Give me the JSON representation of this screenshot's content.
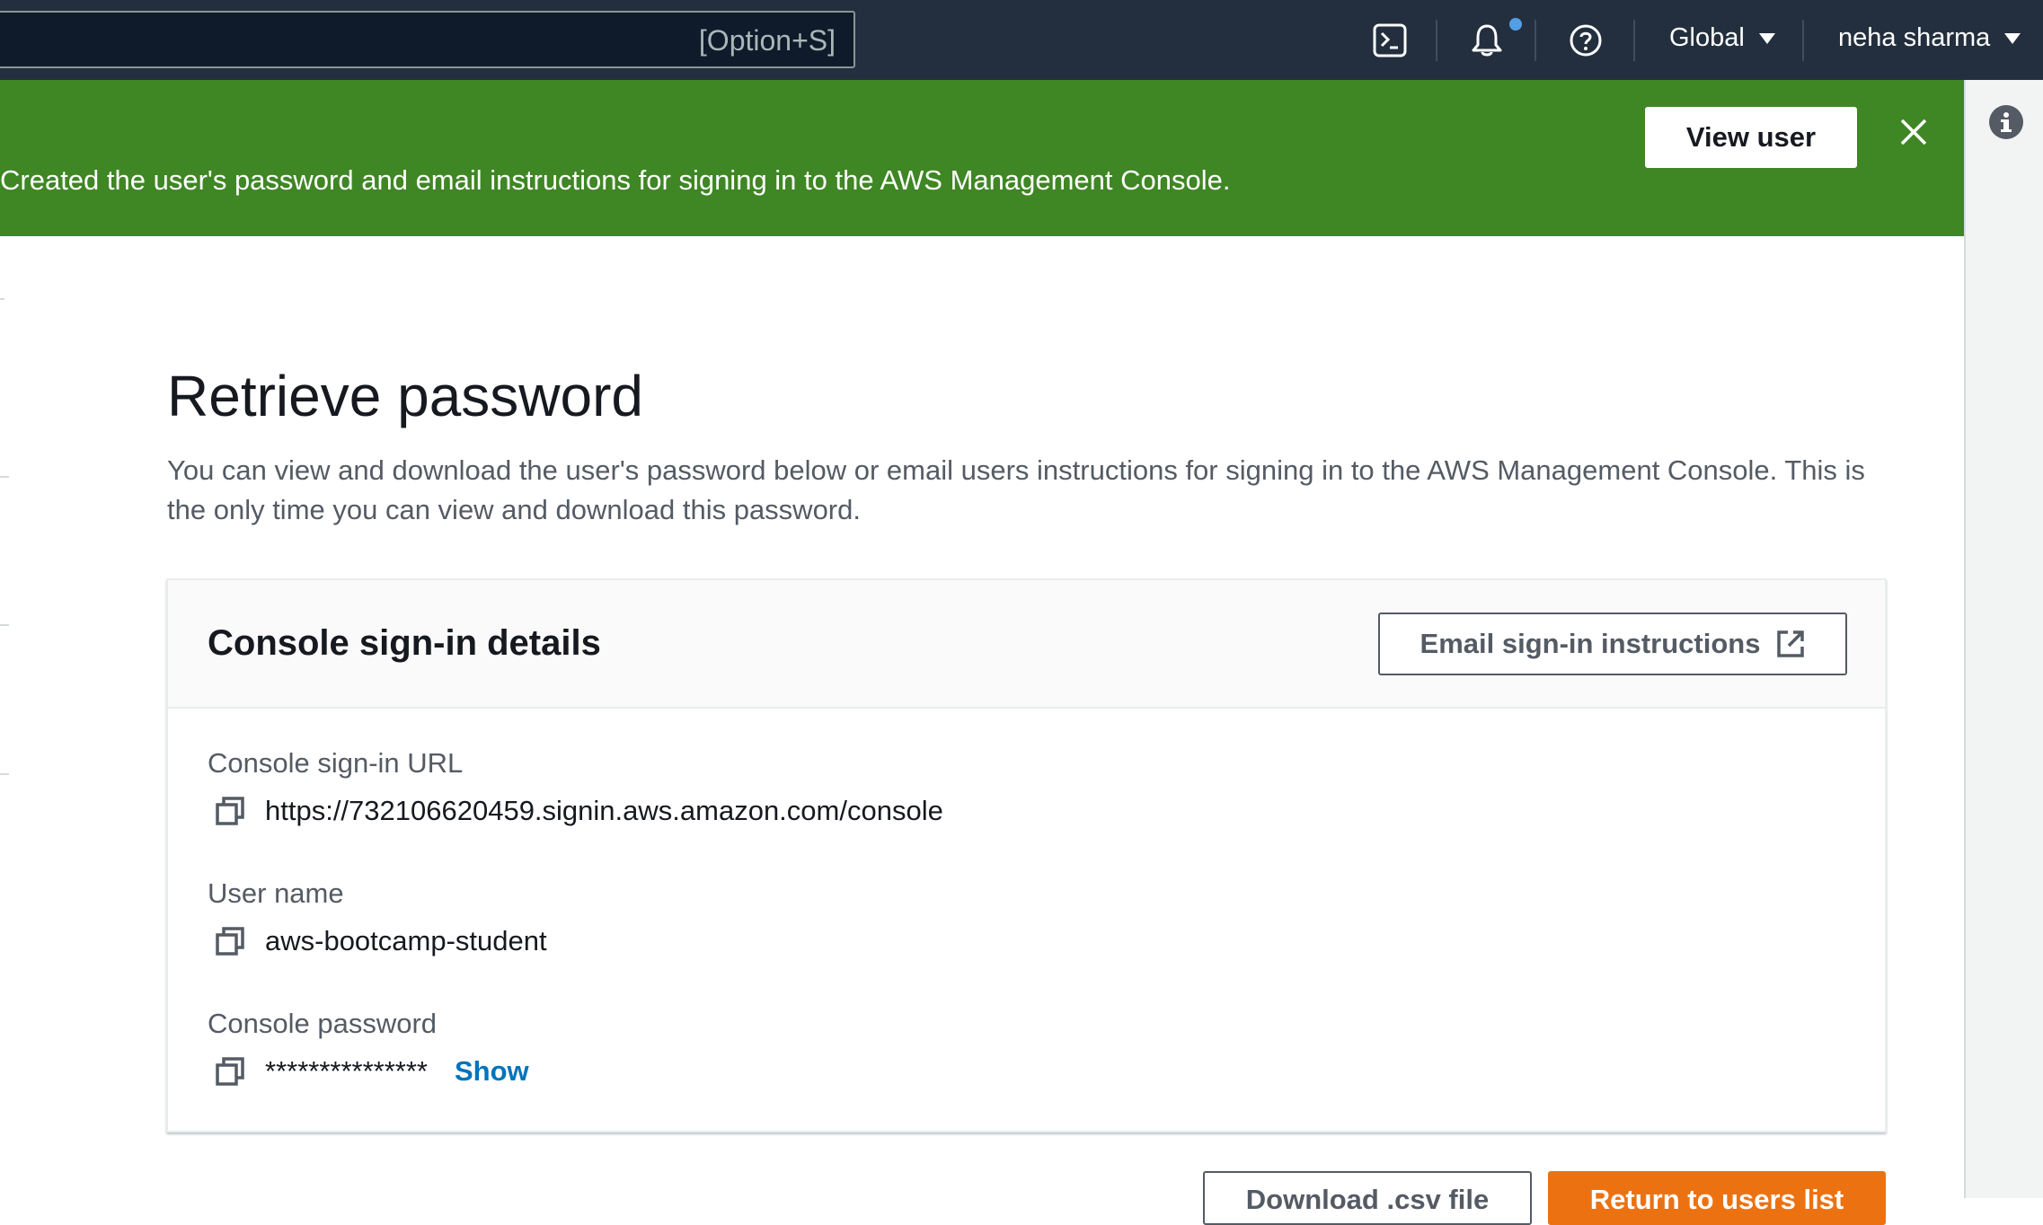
{
  "topbar": {
    "search_shortcut": "[Option+S]",
    "icons": [
      "cloudshell-icon",
      "bell-icon",
      "help-icon"
    ],
    "region_label": "Global",
    "user_label": "neha sharma"
  },
  "flash": {
    "message": "Created the user's password and email instructions for signing in to the AWS Management Console.",
    "view_user_label": "View user",
    "bg_color": "#3f8624"
  },
  "main": {
    "title": "Retrieve password",
    "description": "You can view and download the user's password below or email users instructions for signing in to the AWS Management Console. This is the only time you can view and download this password."
  },
  "card": {
    "title": "Console sign-in details",
    "email_button_label": "Email sign-in instructions",
    "fields": [
      {
        "label": "Console sign-in URL",
        "value": "https://732106620459.signin.aws.amazon.com/console"
      },
      {
        "label": "User name",
        "value": "aws-bootcamp-student"
      },
      {
        "label": "Console password",
        "value": "***************",
        "show_label": "Show"
      }
    ]
  },
  "actions": {
    "download_label": "Download .csv file",
    "return_label": "Return to users list",
    "primary_color": "#ec7211"
  }
}
